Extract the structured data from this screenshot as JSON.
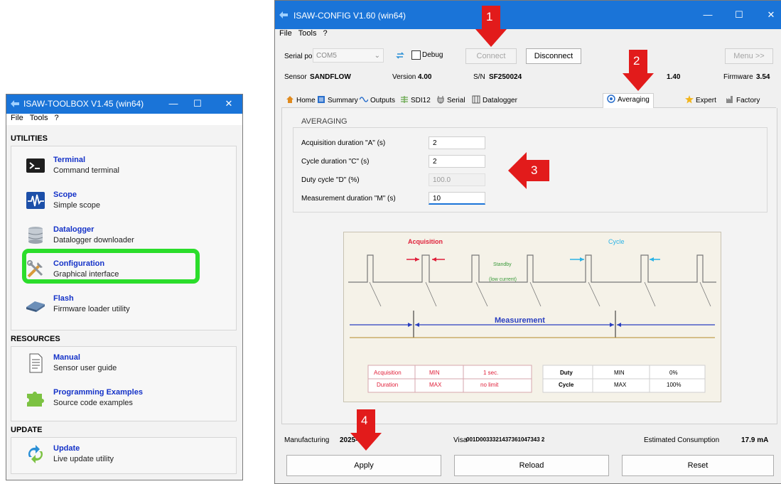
{
  "toolbox": {
    "title": "ISAW-TOOLBOX V1.45 (win64)",
    "menu": [
      "File",
      "Tools",
      "?"
    ],
    "sections": {
      "utilities": "UTILITIES",
      "resources": "RESOURCES",
      "update": "UPDATE"
    },
    "tools": [
      {
        "name": "Terminal",
        "desc": "Command terminal",
        "icon": "terminal-icon"
      },
      {
        "name": "Scope",
        "desc": "Simple scope",
        "icon": "scope-icon"
      },
      {
        "name": "Datalogger",
        "desc": "Datalogger downloader",
        "icon": "database-icon"
      },
      {
        "name": "Configuration",
        "desc": "Graphical interface",
        "icon": "tools-icon"
      },
      {
        "name": "Flash",
        "desc": "Firmware loader utility",
        "icon": "flash-chip-icon"
      },
      {
        "name": "Manual",
        "desc": "Sensor user guide",
        "icon": "document-icon"
      },
      {
        "name": "Programming Examples",
        "desc": "Source code examples",
        "icon": "puzzle-icon"
      },
      {
        "name": "Update",
        "desc": "Live update utility",
        "icon": "refresh-icon"
      }
    ],
    "highlight_color": "#2bdd2b"
  },
  "config": {
    "title": "ISAW-CONFIG V1.60 (win64)",
    "menu": [
      "File",
      "Tools",
      "?"
    ],
    "serial_port_label": "Serial port",
    "serial_port_value": "COM5",
    "debug_label": "Debug",
    "connect_label": "Connect",
    "disconnect_label": "Disconnect",
    "menu_button_label": "Menu >>",
    "sensor_label": "Sensor",
    "sensor_value": "SANDFLOW",
    "version_label": "Version",
    "version_value": "4.00",
    "sn_label": "S/N",
    "sn_value": "SF250024",
    "hardware_value": "1.40",
    "firmware_label": "Firmware",
    "firmware_value": "3.54",
    "tabs": [
      "Home",
      "Summary",
      "Outputs",
      "SDI12",
      "Serial",
      "Datalogger",
      "Averaging",
      "Expert",
      "Factory"
    ],
    "averaging": {
      "title": "AVERAGING",
      "rows": [
        {
          "label": "Acquisition duration \"A\" (s)",
          "value": "2"
        },
        {
          "label": "Cycle duration \"C\" (s)",
          "value": "2"
        },
        {
          "label": "Duty cycle \"D\" (%)",
          "value": "100.0"
        },
        {
          "label": "Measurement duration \"M\" (s)",
          "value": "10"
        }
      ]
    },
    "diagram": {
      "acquisition": "Acquisition",
      "cycle": "Cycle",
      "standby": "Standby",
      "low_current": "(low current)",
      "measurement": "Measurement",
      "table": {
        "left_label_1": "Acquisition",
        "left_label_2": "Duration",
        "min": "MIN",
        "max": "MAX",
        "min_value": "1 sec.",
        "max_value": "no limit",
        "duty_1": "Duty",
        "duty_2": "Cycle",
        "duty_min": "0%",
        "duty_max": "100%"
      }
    },
    "manufacturing_label": "Manufacturing",
    "manufacturing_value": "2025-",
    "vise_label": "Visa",
    "vise_value": "001D0033321437361047343 2",
    "consumption_label": "Estimated Consumption",
    "consumption_value": "17.9 mA",
    "apply_label": "Apply",
    "reload_label": "Reload",
    "reset_label": "Reset"
  },
  "callouts": [
    "1",
    "2",
    "3",
    "4"
  ],
  "colors": {
    "titlebar": "#1a74d8",
    "callout": "#e21b1b",
    "link": "#1432c8"
  }
}
